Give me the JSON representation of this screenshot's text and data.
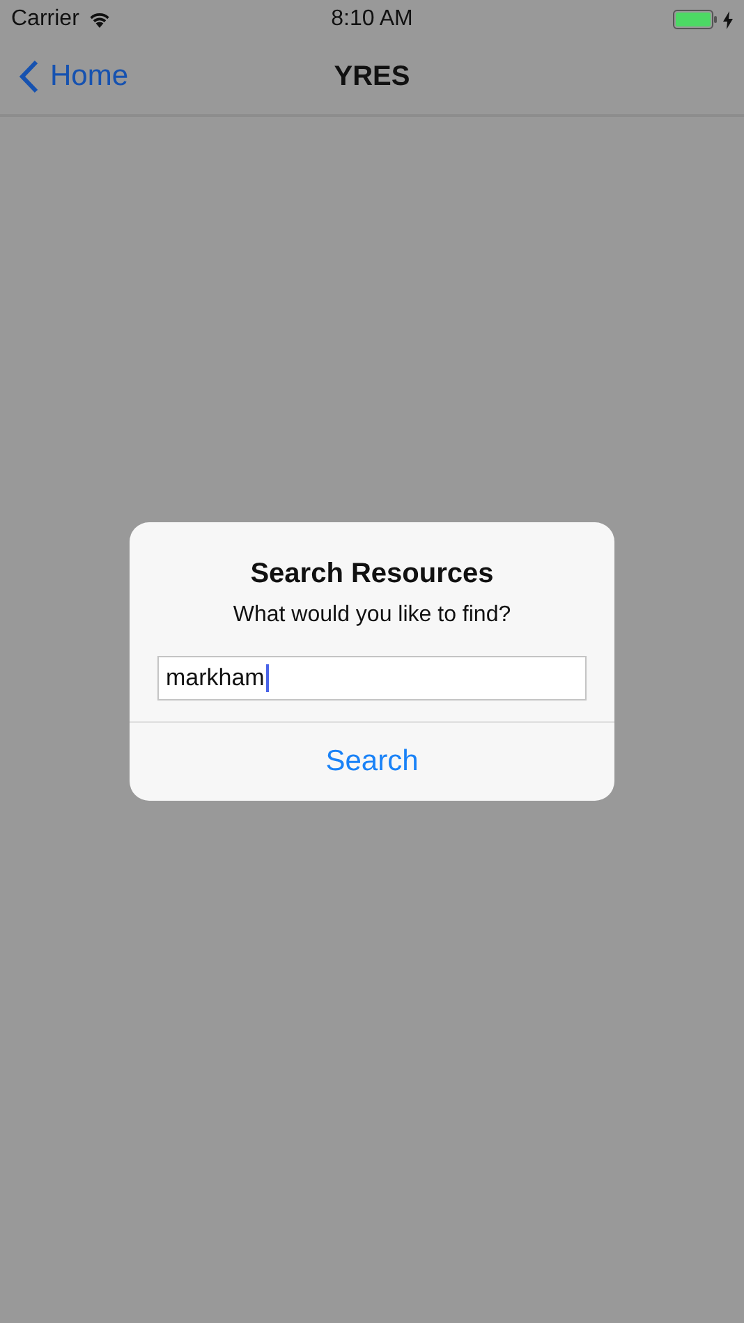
{
  "status_bar": {
    "carrier": "Carrier",
    "time": "8:10 AM"
  },
  "nav_bar": {
    "back_label": "Home",
    "title": "YRES"
  },
  "alert": {
    "title": "Search Resources",
    "message": "What would you like to find?",
    "field_value": "markham",
    "buttons": [
      "Search"
    ]
  }
}
